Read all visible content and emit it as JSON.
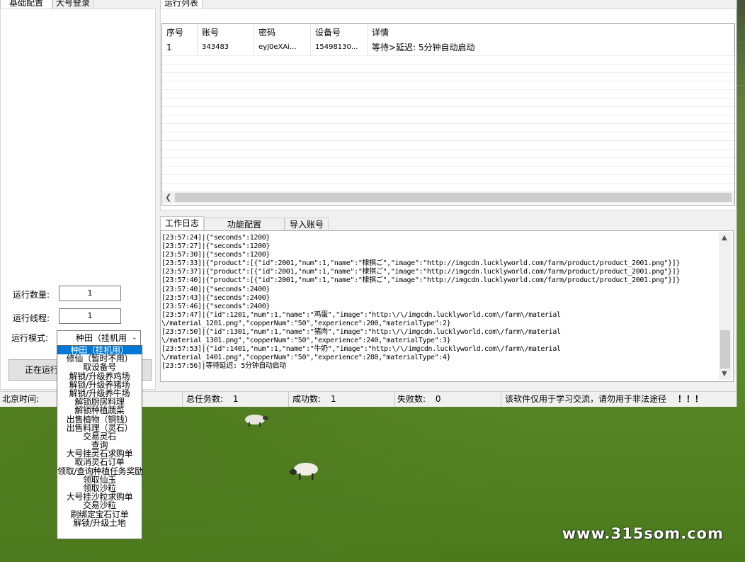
{
  "left_tabs": [
    "基础配置",
    "大号登录"
  ],
  "form": {
    "count_label": "运行数量:",
    "count_value": "1",
    "threads_label": "运行线程:",
    "threads_value": "1",
    "mode_label": "运行模式:",
    "mode_value": "种田（挂机用"
  },
  "run_button": "正在运行",
  "mode_options": [
    "种田（挂机用）",
    "修仙（暂时不用）",
    "取设备号",
    "解锁/升级养鸡场",
    "解锁/升级养猪场",
    "解锁/升级养牛场",
    "解锁厨房料理",
    "解锁种植蔬菜",
    "出售植物（铜钱）",
    "出售料理（灵石）",
    "交易灵石",
    "查询",
    "大号挂灵石求购单",
    "取消灵石订单",
    "领取/查询种植任务奖励",
    "领取仙玉",
    "领取沙粒",
    "大号挂沙粒求购单",
    "交易沙粒",
    "刷绑定宝石订单",
    "解锁/升级土地"
  ],
  "run_list": {
    "tab": "运行列表",
    "headers": [
      "序号",
      "账号",
      "密码",
      "设备号",
      "详情"
    ],
    "rows": [
      [
        "1",
        "343483",
        "eyJ0eXAi...",
        "15498130...",
        "等待>延迟: 5分钟自动启动"
      ]
    ]
  },
  "log_tabs": [
    "工作日志",
    "功能配置",
    "导入账号"
  ],
  "log_lines": [
    "[23:57:24]|{\"seconds\":1200}",
    "[23:57:27]|{\"seconds\":1200}",
    "[23:57:30]|{\"seconds\":1200}",
    "[23:57:33]|{\"product\":[{\"id\":2001,\"num\":1,\"name\":\"棣掑ご\",\"image\":\"http://imgcdn.lucklyworld.com/farm/product/product_2001.png\"}]}",
    "[23:57:37]|{\"product\":[{\"id\":2001,\"num\":1,\"name\":\"棣掑ご\",\"image\":\"http://imgcdn.lucklyworld.com/farm/product/product_2001.png\"}]}",
    "[23:57:40]|{\"product\":[{\"id\":2001,\"num\":1,\"name\":\"棣掑ご\",\"image\":\"http://imgcdn.lucklyworld.com/farm/product/product_2001.png\"}]}",
    "[23:57:40]|{\"seconds\":2400}",
    "[23:57:43]|{\"seconds\":2400}",
    "[23:57:46]|{\"seconds\":2400}",
    "[23:57:47]|{\"id\":1201,\"num\":1,\"name\":\"鸡蛋\",\"image\":\"http:\\/\\/imgcdn.lucklyworld.com\\/farm\\/material",
    "\\/material_1201.png\",\"copperNum\":\"50\",\"experience\":200,\"materialType\":2}",
    "[23:57:50]|{\"id\":1301,\"num\":1,\"name\":\"猪肉\",\"image\":\"http:\\/\\/imgcdn.lucklyworld.com\\/farm\\/material",
    "\\/material_1301.png\",\"copperNum\":\"50\",\"experience\":240,\"materialType\":3}",
    "[23:57:53]|{\"id\":1401,\"num\":1,\"name\":\"牛奶\",\"image\":\"http:\\/\\/imgcdn.lucklyworld.com\\/farm\\/material",
    "\\/material_1401.png\",\"copperNum\":\"50\",\"experience\":280,\"materialType\":4}",
    "[23:57:56]|等待延迟: 5分钟自动启动"
  ],
  "status": {
    "time_label": "北京时间:",
    "total_label": "总任务数:",
    "total_value": "1",
    "success_label": "成功数:",
    "success_value": "1",
    "fail_label": "失败数:",
    "fail_value": "0",
    "notice": "该软件仅用于学习交流，请勿用于非法途径",
    "exclaim": "！！！"
  },
  "watermark": "www.315som.com"
}
